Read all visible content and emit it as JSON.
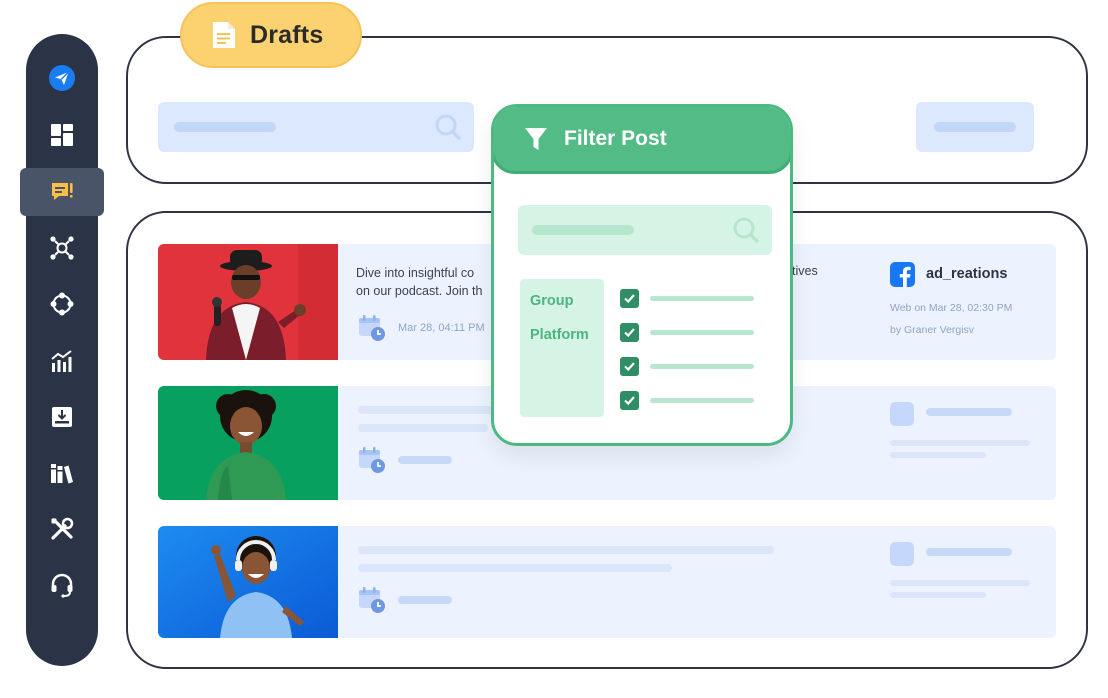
{
  "colors": {
    "sidebar_bg": "#2b3446",
    "sidebar_active": "#4a5468",
    "drafts_tab": "#fcd271",
    "accent_green": "#53bb86",
    "placeholder_blue": "#dbe8fd",
    "row_bg": "#edf3fe",
    "facebook_blue": "#1877f2"
  },
  "sidebar": {
    "items": [
      {
        "icon": "paper-plane-icon"
      },
      {
        "icon": "dashboard-grid-icon"
      },
      {
        "icon": "drafts-comment-icon",
        "active": true
      },
      {
        "icon": "network-icon"
      },
      {
        "icon": "circle-nodes-icon"
      },
      {
        "icon": "analytics-chart-icon"
      },
      {
        "icon": "inbox-download-icon"
      },
      {
        "icon": "library-books-icon"
      },
      {
        "icon": "tools-icon"
      },
      {
        "icon": "headset-support-icon"
      }
    ]
  },
  "header": {
    "title": "Drafts",
    "title_icon": "document-icon",
    "search_icon": "search-icon"
  },
  "filter": {
    "title": "Filter Post",
    "title_icon": "funnel-icon",
    "search_icon": "search-icon",
    "categories": [
      "Group",
      "Platform"
    ],
    "options_checked": [
      true,
      true,
      true,
      true
    ]
  },
  "posts": [
    {
      "text": "Dive into insightful co",
      "text2": "tives",
      "text_line2": "on our podcast. Join th",
      "date": "Mar 28, 04:11 PM",
      "account": {
        "platform_icon": "facebook-icon",
        "name": "ad_reations",
        "published": "Web on Mar 28, 02:30 PM",
        "author": "by Graner Vergisv"
      }
    },
    {},
    {}
  ]
}
